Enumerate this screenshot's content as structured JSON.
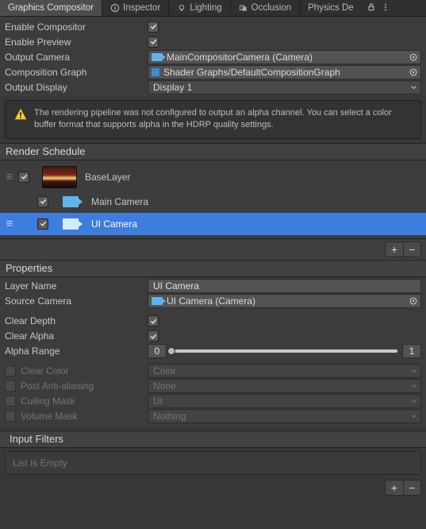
{
  "tabs": {
    "items": [
      {
        "label": "Graphics Compositor"
      },
      {
        "label": "Inspector"
      },
      {
        "label": "Lighting"
      },
      {
        "label": "Occlusion"
      },
      {
        "label": "Physics De"
      }
    ]
  },
  "basic": {
    "enable_compositor": {
      "label": "Enable Compositor"
    },
    "enable_preview": {
      "label": "Enable Preview"
    },
    "output_camera": {
      "label": "Output Camera",
      "value": "MainCompositorCamera (Camera)"
    },
    "composition_graph": {
      "label": "Composition Graph",
      "value": "Shader Graphs/DefaultCompositionGraph"
    },
    "output_display": {
      "label": "Output Display",
      "value": "Display 1"
    }
  },
  "warning": {
    "text": "The rendering pipeline was not configured to output an alpha channel. You can select a color buffer format that supports alpha in the HDRP quality settings."
  },
  "render_schedule": {
    "title": "Render Schedule",
    "layer0": "BaseLayer",
    "layer1": "Main Camera",
    "layer2": "UI Camera",
    "add": "+",
    "remove": "−"
  },
  "properties": {
    "title": "Properties",
    "layer_name": {
      "label": "Layer Name",
      "value": "UI Camera"
    },
    "source_camera": {
      "label": "Source Camera",
      "value": "UI Camera (Camera)"
    },
    "clear_depth": {
      "label": "Clear Depth"
    },
    "clear_alpha": {
      "label": "Clear Alpha"
    },
    "alpha_range": {
      "label": "Alpha Range",
      "min": "0",
      "max": "1"
    },
    "clear_color": {
      "label": "Clear Color",
      "value": "Color"
    },
    "post_aa": {
      "label": "Post Anti-aliasing",
      "value": "None"
    },
    "culling_mask": {
      "label": "Culling Mask",
      "value": "UI"
    },
    "volume_mask": {
      "label": "Volume Mask",
      "value": "Nothing"
    }
  },
  "input_filters": {
    "title": "Input Filters",
    "empty": "List Is Empty",
    "add": "+",
    "remove": "−"
  }
}
